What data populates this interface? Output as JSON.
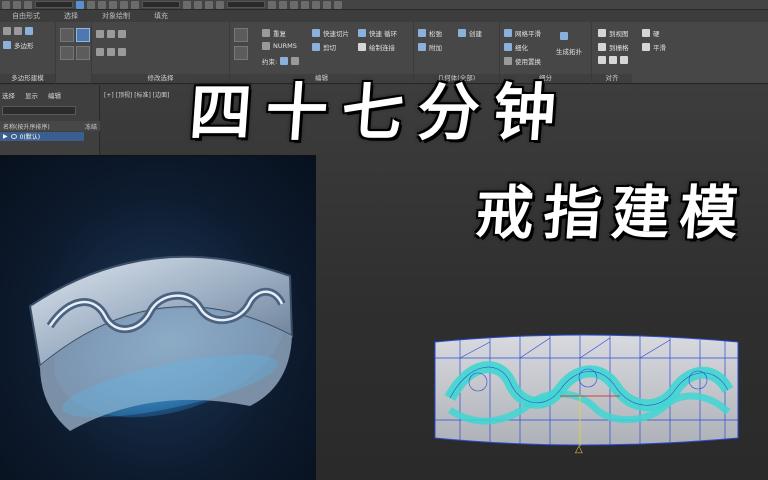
{
  "ribbon": {
    "tabs": [
      "自由形式",
      "选择",
      "对象绘制",
      "填充"
    ],
    "groups": [
      {
        "label": "多边形建模"
      },
      {
        "label": "修改选择"
      },
      {
        "label": "编辑"
      },
      {
        "label": "几何体(全部)"
      },
      {
        "label": "细分"
      },
      {
        "label": "对齐"
      }
    ],
    "buttons": {
      "edge_loop": "重复",
      "nurms": "NURMS",
      "quick_slice": "快速切片",
      "cut": "剪切",
      "quick_loop": "快速 循环",
      "paint_connect": "绘制连接",
      "constraints_label": "约束:",
      "relax": "松弛",
      "create": "创建",
      "attach": "附加",
      "mesh_smooth": "网格平滑",
      "tessellate": "细化",
      "use_displacement": "使用置换",
      "to_view": "到视图",
      "to_grid": "到栅格",
      "hard": "硬",
      "smooth": "平滑",
      "generate_topology": "生成拓扑",
      "polygon_modeling": "多边形"
    }
  },
  "command_panel": {
    "tabs": [
      "选择",
      "显示",
      "编辑"
    ],
    "header_name": "名称(按升序排序)",
    "header_frozen": "冻结",
    "scene_row": "0(默认)"
  },
  "viewport": {
    "label": "[+] [顶视] [标准] [边面]"
  },
  "overlay": {
    "title": "四十七分钟",
    "subtitle": "戒指建模"
  },
  "colors": {
    "wire": "#2b4bd6",
    "pattern": "#3fd6d2",
    "ring_body": "#c9cbd0"
  }
}
